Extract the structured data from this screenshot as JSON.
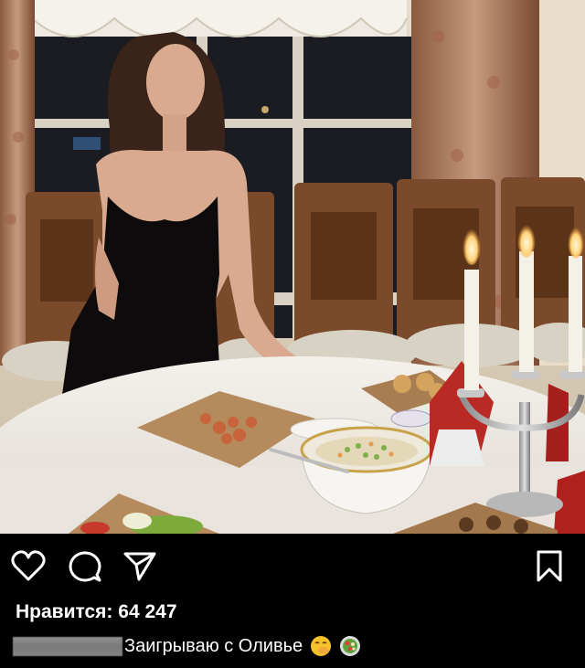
{
  "post": {
    "photo_alt": "",
    "likes_label": "Нравится:",
    "likes_count": "64 247",
    "caption_text": "Заигрываю с Оливье",
    "caption_emojis": [
      "face-with-hand-over-mouth-emoji",
      "salad-emoji"
    ]
  },
  "actions": {
    "icons": [
      "heart-icon",
      "comment-icon",
      "share-icon",
      "bookmark-icon"
    ]
  },
  "colors": {
    "background": "#000000",
    "text": "#ffffff",
    "username_redaction": "#858585"
  }
}
